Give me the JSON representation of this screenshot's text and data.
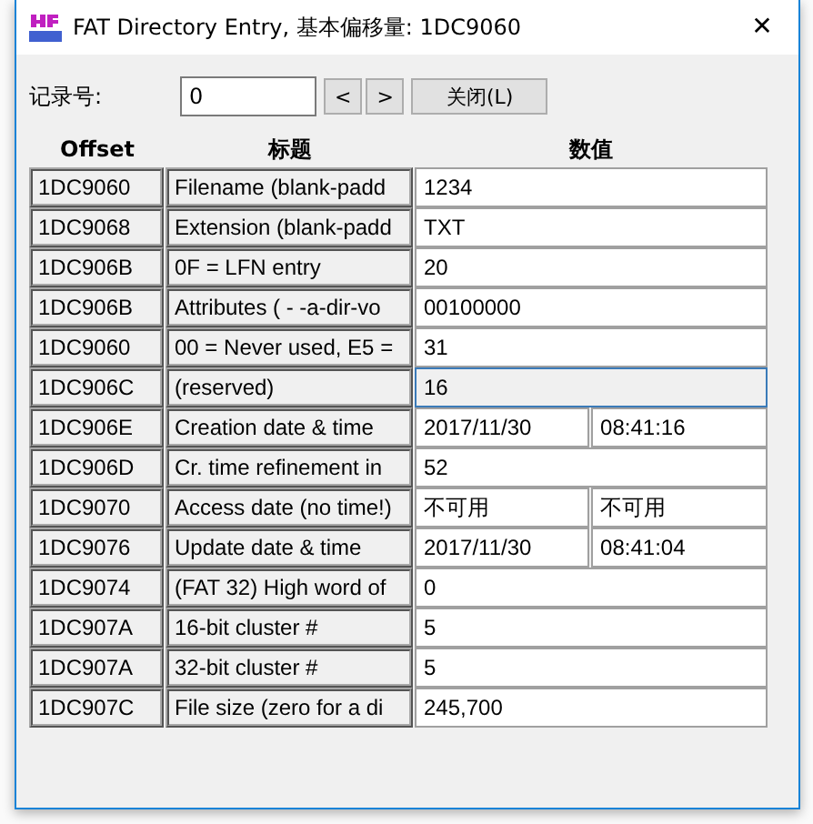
{
  "window": {
    "title": "FAT Directory Entry, 基本偏移量: 1DC9060",
    "close": "✕"
  },
  "record": {
    "label": "记录号:",
    "value": "0",
    "prev": "<",
    "next": ">",
    "close_button": "关闭(L)"
  },
  "table": {
    "columns": [
      "Offset",
      "标题",
      "数值"
    ],
    "rows": [
      {
        "offset": "1DC9060",
        "title": "Filename (blank-padd",
        "kind": "single",
        "values": [
          "1234"
        ],
        "focused": false
      },
      {
        "offset": "1DC9068",
        "title": "Extension (blank-padd",
        "kind": "single",
        "values": [
          "TXT"
        ],
        "focused": false
      },
      {
        "offset": "1DC906B",
        "title": "0F = LFN entry",
        "kind": "single",
        "values": [
          "20"
        ],
        "focused": false
      },
      {
        "offset": "1DC906B",
        "title": "Attributes ( - -a-dir-vo",
        "kind": "single",
        "values": [
          "00100000"
        ],
        "focused": false
      },
      {
        "offset": "1DC9060",
        "title": "00 = Never used, E5 =",
        "kind": "single",
        "values": [
          "31"
        ],
        "focused": false
      },
      {
        "offset": "1DC906C",
        "title": "(reserved)",
        "kind": "single",
        "values": [
          "16"
        ],
        "focused": true
      },
      {
        "offset": "1DC906E",
        "title": "Creation date & time",
        "kind": "split",
        "values": [
          "2017/11/30",
          "08:41:16"
        ],
        "focused": false
      },
      {
        "offset": "1DC906D",
        "title": "Cr. time refinement in",
        "kind": "single",
        "values": [
          "52"
        ],
        "focused": false
      },
      {
        "offset": "1DC9070",
        "title": "Access date (no time!)",
        "kind": "split",
        "values": [
          "不可用",
          "不可用"
        ],
        "focused": false
      },
      {
        "offset": "1DC9076",
        "title": "Update date & time",
        "kind": "split",
        "values": [
          "2017/11/30",
          "08:41:04"
        ],
        "focused": false
      },
      {
        "offset": "1DC9074",
        "title": "(FAT 32) High word of",
        "kind": "single",
        "values": [
          "0"
        ],
        "focused": false
      },
      {
        "offset": "1DC907A",
        "title": "16-bit cluster #",
        "kind": "single",
        "values": [
          "5"
        ],
        "focused": false
      },
      {
        "offset": "1DC907A",
        "title": "32-bit cluster #",
        "kind": "single",
        "values": [
          "5"
        ],
        "focused": false
      },
      {
        "offset": "1DC907C",
        "title": "File size (zero for a di",
        "kind": "single",
        "values": [
          "245,700"
        ],
        "focused": false
      }
    ]
  }
}
